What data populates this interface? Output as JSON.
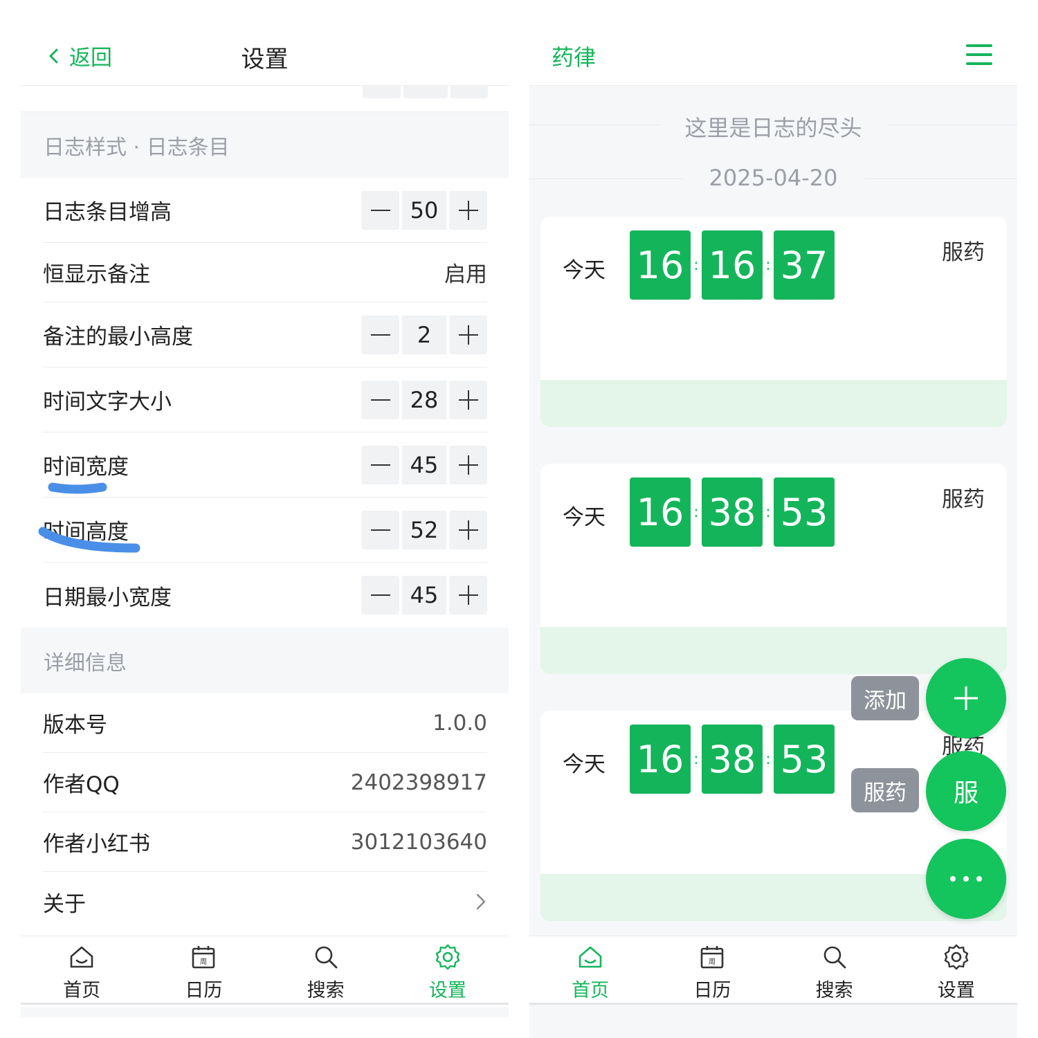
{
  "colors": {
    "accent": "#14b55a",
    "stepper_bg": "#f1f2f4",
    "section_bg": "#f6f7f9",
    "card_footer": "#e4f5ea",
    "fab_label_bg": "#8e939b",
    "annotation": "#4a8fe7"
  },
  "settings": {
    "back_label": "返回",
    "title": "设置",
    "section_log": "日志样式 · 日志条目",
    "rows": [
      {
        "label": "日志条目增高",
        "value": "50"
      },
      {
        "label": "恒显示备注",
        "value": "启用"
      },
      {
        "label": "备注的最小高度",
        "value": "2"
      },
      {
        "label": "时间文字大小",
        "value": "28"
      },
      {
        "label": "时间宽度",
        "value": "45"
      },
      {
        "label": "时间高度",
        "value": "52"
      },
      {
        "label": "日期最小宽度",
        "value": "45"
      }
    ],
    "section_info": "详细信息",
    "info_rows": [
      {
        "label": "版本号",
        "value": "1.0.0"
      },
      {
        "label": "作者QQ",
        "value": "2402398917"
      },
      {
        "label": "作者小红书",
        "value": "3012103640"
      },
      {
        "label": "关于",
        "value": ""
      }
    ],
    "tabs": [
      {
        "label": "首页",
        "icon": "home-icon"
      },
      {
        "label": "日历",
        "icon": "calendar-icon",
        "glyph": "周"
      },
      {
        "label": "搜索",
        "icon": "search-icon"
      },
      {
        "label": "设置",
        "icon": "gear-icon"
      }
    ],
    "active_tab": 3
  },
  "log": {
    "app_title": "药律",
    "end_text": "这里是日志的尽头",
    "date": "2025-04-20",
    "entries": [
      {
        "day": "今天",
        "h": "16",
        "m": "16",
        "s": "37",
        "kind": "服药"
      },
      {
        "day": "今天",
        "h": "16",
        "m": "38",
        "s": "53",
        "kind": "服药"
      },
      {
        "day": "今天",
        "h": "16",
        "m": "38",
        "s": "53",
        "kind": "服药"
      }
    ],
    "fab": {
      "add_label": "添加",
      "add_glyph": "+",
      "take_label": "服药",
      "take_glyph": "服"
    },
    "tabs": [
      {
        "label": "首页",
        "icon": "home-icon"
      },
      {
        "label": "日历",
        "icon": "calendar-icon",
        "glyph": "周"
      },
      {
        "label": "搜索",
        "icon": "search-icon"
      },
      {
        "label": "设置",
        "icon": "gear-icon"
      }
    ],
    "active_tab": 0
  }
}
